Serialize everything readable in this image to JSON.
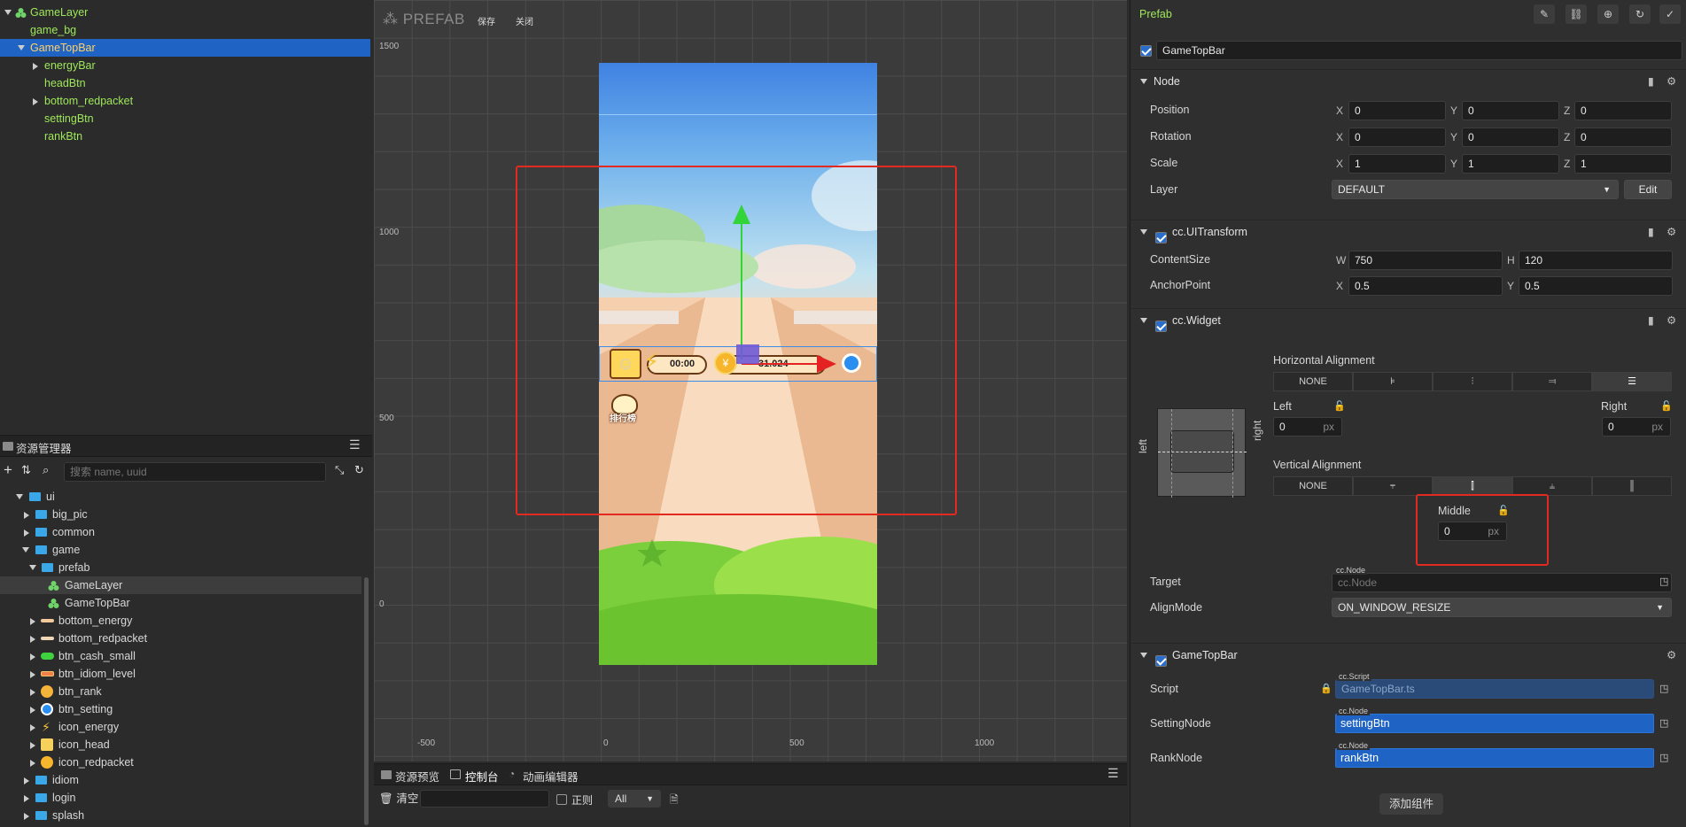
{
  "hierarchy": {
    "items": [
      {
        "label": "GameLayer"
      },
      {
        "label": "game_bg"
      },
      {
        "label": "GameTopBar"
      },
      {
        "label": "energyBar"
      },
      {
        "label": "headBtn"
      },
      {
        "label": "bottom_redpacket"
      },
      {
        "label": "settingBtn"
      },
      {
        "label": "rankBtn"
      }
    ]
  },
  "assets": {
    "tab_title": "资源管理器",
    "search_placeholder": "搜索 name, uuid",
    "items": [
      {
        "label": "ui"
      },
      {
        "label": "big_pic"
      },
      {
        "label": "common"
      },
      {
        "label": "game"
      },
      {
        "label": "prefab"
      },
      {
        "label": "GameLayer"
      },
      {
        "label": "GameTopBar"
      },
      {
        "label": "bottom_energy"
      },
      {
        "label": "bottom_redpacket"
      },
      {
        "label": "btn_cash_small"
      },
      {
        "label": "btn_idiom_level"
      },
      {
        "label": "btn_rank"
      },
      {
        "label": "btn_setting"
      },
      {
        "label": "icon_energy"
      },
      {
        "label": "icon_head"
      },
      {
        "label": "icon_redpacket"
      },
      {
        "label": "idiom"
      },
      {
        "label": "login"
      },
      {
        "label": "splash"
      }
    ]
  },
  "scene": {
    "prefab_label": "PREFAB",
    "save_label": "保存",
    "close_label": "关闭",
    "y_axis": [
      "1500",
      "1000",
      "500",
      "0"
    ],
    "x_axis": [
      "-500",
      "0",
      "500",
      "1000"
    ],
    "game": {
      "timer": "00:00",
      "coins": "31.024",
      "rank_label": "排行榜"
    }
  },
  "console": {
    "tabs": [
      "资源预览",
      "控制台",
      "动画编辑器"
    ],
    "clear_label": "清空",
    "regex_label": "正则",
    "level_select": "All"
  },
  "inspector": {
    "title": "Prefab",
    "node_name": "GameTopBar",
    "node_section": "Node",
    "position": {
      "label": "Position",
      "x": "0",
      "y": "0",
      "z": "0"
    },
    "rotation": {
      "label": "Rotation",
      "x": "0",
      "y": "0",
      "z": "0"
    },
    "scale": {
      "label": "Scale",
      "x": "1",
      "y": "1",
      "z": "1"
    },
    "layer": {
      "label": "Layer",
      "value": "DEFAULT",
      "edit": "Edit"
    },
    "uitransform": {
      "title": "cc.UITransform",
      "content_size_label": "ContentSize",
      "w": "750",
      "h": "120",
      "anchor_label": "AnchorPoint",
      "ax": "0.5",
      "ay": "0.5"
    },
    "widget": {
      "title": "cc.Widget",
      "h_align_label": "Horizontal Alignment",
      "v_align_label": "Vertical Alignment",
      "none": "NONE",
      "left_label": "Left",
      "right_label": "Right",
      "left_value": "0",
      "right_value": "0",
      "middle_label": "Middle",
      "middle_value": "0",
      "unit": "px",
      "side_left": "left",
      "side_right": "right",
      "target_label": "Target",
      "target_tag": "cc.Node",
      "target_placeholder": "cc.Node",
      "alignmode_label": "AlignMode",
      "alignmode_value": "ON_WINDOW_RESIZE"
    },
    "script_comp": {
      "title": "GameTopBar",
      "script_label": "Script",
      "script_tag": "cc.Script",
      "script_value": "GameTopBar.ts",
      "setting_label": "SettingNode",
      "setting_tag": "cc.Node",
      "setting_value": "settingBtn",
      "rank_label": "RankNode",
      "rank_tag": "cc.Node",
      "rank_value": "rankBtn"
    },
    "add_component": "添加组件"
  },
  "colors": {
    "accent": "#1f64c4",
    "highlight_red": "#e22a21",
    "node_green": "#9ee85a",
    "selected_text": "#ffd166"
  }
}
